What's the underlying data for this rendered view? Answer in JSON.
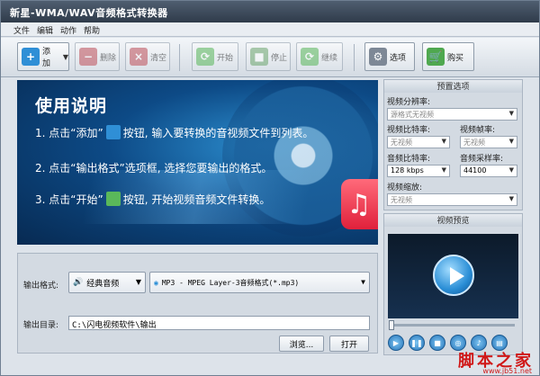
{
  "window": {
    "title": "新星-WMA/WAV音频格式转换器"
  },
  "menu": [
    "文件",
    "编辑",
    "动作",
    "帮助"
  ],
  "toolbar": {
    "add": "添加",
    "delete": "删除",
    "clear": "清空",
    "start": "开始",
    "stop": "停止",
    "resume": "继续",
    "options": "选项",
    "buy": "购买"
  },
  "banner": {
    "title": "使用说明",
    "step1a": "1. 点击“添加”",
    "step1b": "按钮, 输入要转换的音视频文件到列表。",
    "step2": "2. 点击“输出格式”选项框, 选择您要输出的格式。",
    "step3a": "3. 点击“开始”",
    "step3b": "按钮, 开始视频音频文件转换。"
  },
  "output": {
    "format_label": "输出格式:",
    "category": "经典音频",
    "format": "MP3 - MPEG Layer-3音频格式(*.mp3)",
    "dir_label": "输出目录:",
    "dir_value": "C:\\闪电视频软件\\输出",
    "browse": "浏览...",
    "open": "打开"
  },
  "preset": {
    "title": "预置选项",
    "resolution_label": "视频分辨率:",
    "resolution_value": "源格式无视频",
    "vbitrate_label": "视频比特率:",
    "vbitrate_value": "无视频",
    "fps_label": "视频帧率:",
    "fps_value": "无视频",
    "abitrate_label": "音频比特率:",
    "abitrate_value": "128 kbps",
    "samplerate_label": "音频采样率:",
    "samplerate_value": "44100",
    "zoom_label": "视频缩放:",
    "zoom_value": "无视频"
  },
  "preview": {
    "title": "视频预览",
    "position": 0
  },
  "watermark": {
    "text": "脚本之家",
    "url": "www.jb51.net"
  },
  "colors": {
    "banner_bg": "#0d4a86",
    "accent": "#2a8ed6",
    "watermark": "#d01818"
  }
}
